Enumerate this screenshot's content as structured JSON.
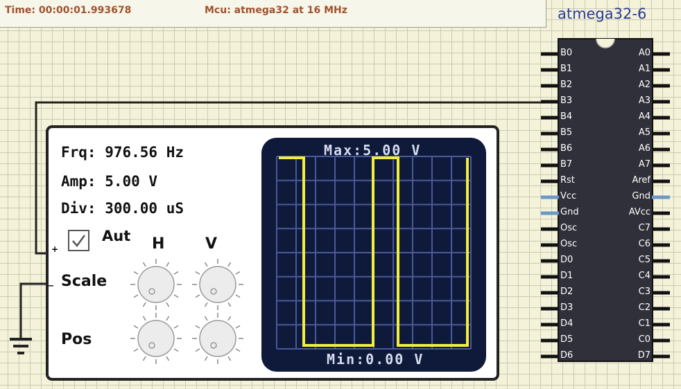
{
  "status": {
    "time": "Time: 00:00:01.993678",
    "mcu": "Mcu: atmega32 at 16 MHz"
  },
  "chip": {
    "title": "atmega32-6",
    "left_pins": [
      "B0",
      "B1",
      "B2",
      "B3",
      "B4",
      "B5",
      "B6",
      "B7",
      "Rst",
      "Vcc",
      "Gnd",
      "Osc",
      "Osc",
      "D0",
      "D1",
      "D2",
      "D3",
      "D4",
      "D5",
      "D6"
    ],
    "right_pins": [
      "A0",
      "A1",
      "A2",
      "A3",
      "A4",
      "A5",
      "A6",
      "A7",
      "Aref",
      "Gnd",
      "AVcc",
      "C7",
      "C6",
      "C5",
      "C4",
      "C3",
      "C2",
      "C1",
      "C0",
      "D7"
    ]
  },
  "oscope": {
    "frq": "Frq: 976.56 Hz",
    "amp": "Amp: 5.00 V",
    "div": "Div:  300.00 uS",
    "auto_label": "Aut",
    "h_label": "H",
    "v_label": "V",
    "scale_label": "Scale",
    "pos_label": "Pos",
    "plus": "+",
    "minus": "_",
    "max_label": "Max:5.00 V",
    "min_label": "Min:0.00 V"
  },
  "colors": {
    "wave": "#f2ee3a",
    "screen": "#0f1a3a",
    "grid": "#4a5a9a",
    "status_text": "#a0522d",
    "power_pin": "#6a98c8"
  }
}
